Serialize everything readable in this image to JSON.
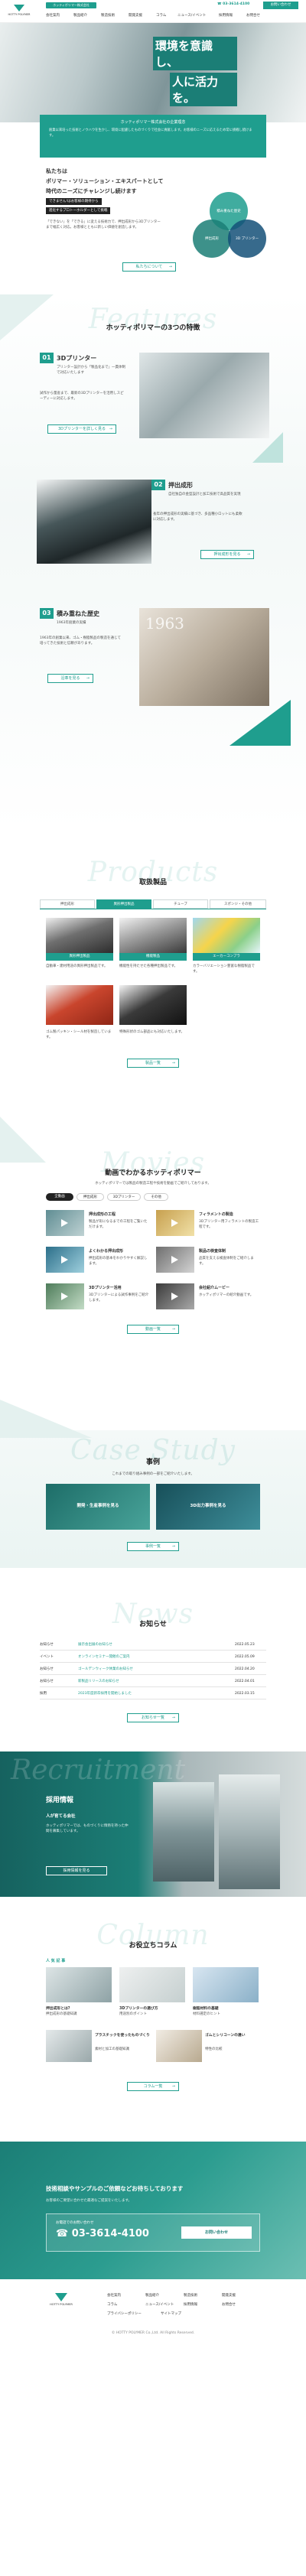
{
  "header": {
    "logo_text": "HOTTY POLYMER",
    "top_pill": "ホッティポリマー株式会社",
    "nav": [
      "会社案内",
      "製品紹介",
      "製造技術",
      "開発支援",
      "コラム",
      "ニュース/イベント",
      "採用情報",
      "お問合せ"
    ],
    "phone": "03-3614-4100",
    "contact_button": "お問い合わせ"
  },
  "hero": {
    "catch_line1": "環境を意識し、",
    "catch_line2": "人に活力を。",
    "sub_label": "ホッティポリマー株式会社の企業理念",
    "desc": "創業以来培った技術とノウハウを生かし、環境に配慮したものづくりで社会に貢献します。お客様のニーズに応えるため常に挑戦し続けます。"
  },
  "intro": {
    "title_line1": "私たちは",
    "title_line2": "ポリマー・ソリューション・エキスパートとして",
    "title_line3": "時代のニーズにチャレンジし続けます",
    "badge1": "できません!はお客様の期待から",
    "badge2": "進化するプロトーホルダーとして挑戦",
    "body": "「できない」を「できる」に変える技術力で、押出成形から3Dプリンターまで幅広く対応。お客様とともに新しい価値を創造します。",
    "button": "私たちについて",
    "venn": [
      "積み重ねた歴史",
      "押出成形",
      "3D プリンター"
    ]
  },
  "features": {
    "en": "Features",
    "jp": "ホッティポリマーの3つの特徴",
    "items": [
      {
        "num": "01",
        "title": "3Dプリンター",
        "lead": "プリンター設計から「製品化まで」一貫体制で対応いたします",
        "body": "試作から量産まで、最新の3Dプリンターを活用しスピーディーに対応します。",
        "button": "3Dプリンターを詳しく見る"
      },
      {
        "num": "02",
        "title": "押出成形",
        "lead": "自社独自の金型設計と加工技術で高品質を実現",
        "body": "長年の押出成形の実績に基づき、多品種小ロットにも柔軟に対応します。",
        "button": "押出成形を見る"
      },
      {
        "num": "03",
        "title": "積み重ねた歴史",
        "lead": "1963年創業の実績",
        "body": "1963年の創業以来、ゴム・樹脂製品の製造を通じて培ってきた技術と信頼があります。",
        "button": "沿革を見る"
      }
    ],
    "photo_label": "1963"
  },
  "products": {
    "en": "Products",
    "jp": "取扱製品",
    "tabs": [
      "押出成形",
      "異形押出製品",
      "チューブ",
      "スポンジ・その他"
    ],
    "cards": [
      {
        "label": "異形押出製品",
        "text": "自動車・建材用途の異形押出製品です。"
      },
      {
        "label": "機能製品",
        "text": "機能性を持たせた各種押出製品です。"
      },
      {
        "label": "エーカーコンプラ",
        "text": "カラーバリエーション豊富な樹脂製品です。"
      },
      {
        "label": "",
        "text": "ゴム製パッキン・シール材を製造しています。"
      },
      {
        "label": "",
        "text": "特殊形状のゴム部品にも対応いたします。"
      }
    ],
    "button": "製品一覧"
  },
  "movies": {
    "en": "Movies",
    "jp": "動画でわかるホッティポリマー",
    "desc": "ホッティポリマーでは製品の製造工程や技術を動画でご紹介しております。",
    "chips": [
      "全動画",
      "押出成形",
      "3Dプリンター",
      "その他"
    ],
    "items": [
      {
        "title": "押出成形の工程",
        "text": "製品が形になるまでの工程をご覧いただけます。"
      },
      {
        "title": "フィラメントの製造",
        "text": "3Dプリンター用フィラメントの製造工程です。"
      },
      {
        "title": "よくわかる押出成形",
        "text": "押出成形の基本をわかりやすく解説します。"
      },
      {
        "title": "製品の検査体制",
        "text": "品質を支える検査体制をご紹介します。"
      },
      {
        "title": "3Dプリンター活用",
        "text": "3Dプリンターによる試作事例をご紹介します。"
      },
      {
        "title": "会社紹介ムービー",
        "text": "ホッティポリマーの紹介動画です。"
      }
    ],
    "button": "動画一覧"
  },
  "cases": {
    "en": "Case Study",
    "jp": "事例",
    "desc": "これまでの取り組み事例の一部をご紹介いたします。",
    "items": [
      "開発・生産事例を見る",
      "3D出力事例を見る"
    ],
    "button": "事例一覧"
  },
  "news": {
    "en": "News",
    "jp": "お知らせ",
    "rows": [
      {
        "tag": "お知らせ",
        "title": "展示会出展のお知らせ",
        "date": "2022.05.23"
      },
      {
        "tag": "イベント",
        "title": "オンラインセミナー開催のご案内",
        "date": "2022.05.09"
      },
      {
        "tag": "お知らせ",
        "title": "ゴールデンウィーク休業のお知らせ",
        "date": "2022.04.20"
      },
      {
        "tag": "お知らせ",
        "title": "新製品リリースのお知らせ",
        "date": "2022.04.01"
      },
      {
        "tag": "採用",
        "title": "2023年度新卒採用を開始しました",
        "date": "2022.03.15"
      }
    ],
    "button": "お知らせ一覧"
  },
  "recruit": {
    "en": "Recruitment",
    "title": "採用情報",
    "lead": "人が育てる会社",
    "text": "ホッティポリマーでは、ものづくりに情熱を持った仲間を募集しています。",
    "button": "採用情報を見る"
  },
  "column": {
    "en": "Column",
    "jp": "お役立ちコラム",
    "ranking": "人 気 記 事",
    "items": [
      {
        "title": "押出成形とは?",
        "text": "押出成形の基礎知識"
      },
      {
        "title": "3Dプリンターの選び方",
        "text": "用途別のポイント"
      },
      {
        "title": "樹脂材料の基礎",
        "text": "材料選定のヒント"
      },
      {
        "title": "プラスチックを使ったものづくり",
        "text": "素材と加工の基礎知識"
      },
      {
        "title": "ゴムとシリコーンの違い",
        "text": "特性の比較"
      }
    ],
    "button": "コラム一覧"
  },
  "cta": {
    "title": "技術相談やサンプルのご依頼などお待ちしております",
    "text": "お客様のご要望に合わせた最適なご提案をいたします。",
    "tel_label": "お電話でのお問い合わせ",
    "tel": "03-3614-4100",
    "button": "お問い合わせ"
  },
  "footer": {
    "logo_text": "HOTTY POLYMER",
    "links": [
      "会社案内",
      "製品紹介",
      "製造技術",
      "開発支援",
      "コラム",
      "ニュース/イベント",
      "採用情報",
      "お問合せ",
      "プライバシーポリシー",
      "サイトマップ"
    ],
    "copyright": "© HOTTY POLYMER Co.,Ltd. All Rights Reserved."
  },
  "colors": {
    "accent": "#1f9e8e",
    "dark": "#1b7e76"
  }
}
